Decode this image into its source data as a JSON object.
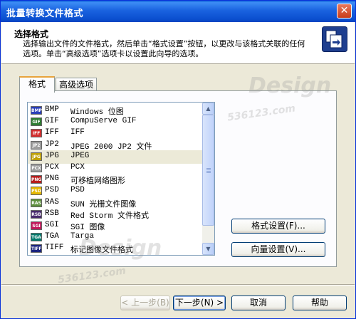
{
  "window": {
    "title": "批量转换文件格式",
    "close_label": "✕"
  },
  "header": {
    "title": "选择格式",
    "description": "选择输出文件的文件格式，然后单击“格式设置”按钮，以更改与该格式关联的任何选项。单击“高级选项”选项卡以设置此向导的选项。",
    "icon": "copy-files-icon"
  },
  "tabs": [
    {
      "label": "格式"
    },
    {
      "label": "高级选项"
    }
  ],
  "formats": [
    {
      "ext": "BMP",
      "desc": "Windows 位图",
      "icon_color": "#2b3fb8"
    },
    {
      "ext": "GIF",
      "desc": "CompuServe GIF",
      "icon_color": "#2e7d32"
    },
    {
      "ext": "IFF",
      "desc": "IFF",
      "icon_color": "#d32f2f"
    },
    {
      "ext": "JP2",
      "desc": "JPEG 2000 JP2 文件",
      "icon_color": "#9e9e9e"
    },
    {
      "ext": "JPG",
      "desc": "JPEG",
      "icon_color": "#c0a000"
    },
    {
      "ext": "PCX",
      "desc": "PCX",
      "icon_color": "#9e9e9e"
    },
    {
      "ext": "PNG",
      "desc": "可移植网络图形",
      "icon_color": "#b71c1c"
    },
    {
      "ext": "PSD",
      "desc": "PSD",
      "icon_color": "#e6b800"
    },
    {
      "ext": "RAS",
      "desc": "SUN 光栅文件图像",
      "icon_color": "#5d8f3c"
    },
    {
      "ext": "RSB",
      "desc": "Red Storm 文件格式",
      "icon_color": "#4a2b6e"
    },
    {
      "ext": "SGI",
      "desc": "SGI 图像",
      "icon_color": "#c2185b"
    },
    {
      "ext": "TGA",
      "desc": "Targa",
      "icon_color": "#00796b"
    },
    {
      "ext": "TIFF",
      "desc": "标记图像文件格式",
      "icon_color": "#1a237e"
    }
  ],
  "selected_format": "JPG",
  "buttons": {
    "format_settings": "格式设置(F)...",
    "vector_settings": "向量设置(V)...",
    "back": "< 上一步(B)",
    "next": "下一步(N) >",
    "cancel": "取消",
    "help": "帮助"
  },
  "watermark": {
    "brand": "Design",
    "number": "536123.com"
  }
}
